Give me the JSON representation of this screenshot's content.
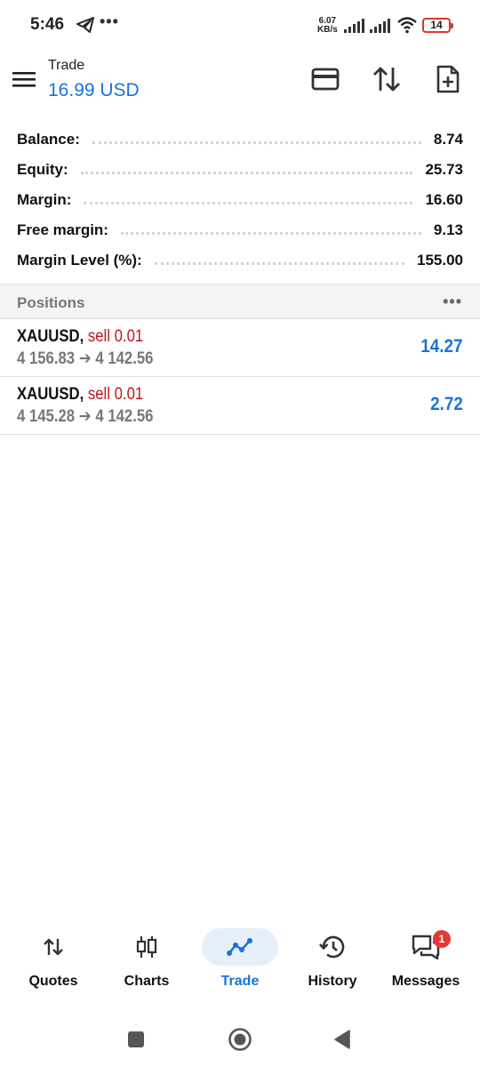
{
  "status_bar": {
    "time": "5:46",
    "more": "•••",
    "speed_value": "6.07",
    "speed_unit": "KB/s",
    "battery": "14"
  },
  "header": {
    "title": "Trade",
    "balance": "16.99 USD",
    "icons": [
      "menu-icon",
      "deposit-card-icon",
      "sort-icon",
      "new-order-icon"
    ]
  },
  "summary": {
    "rows": [
      {
        "label": "Balance:",
        "value": "8.74"
      },
      {
        "label": "Equity:",
        "value": "25.73"
      },
      {
        "label": "Margin:",
        "value": "16.60"
      },
      {
        "label": "Free margin:",
        "value": "9.13"
      },
      {
        "label": "Margin Level (%):",
        "value": "155.00"
      }
    ]
  },
  "positions": {
    "title": "Positions",
    "more": "•••",
    "items": [
      {
        "symbol": "XAUUSD,",
        "side": "sell 0.01",
        "prices": "4 156.83 ➔ 4 142.56",
        "profit": "14.27"
      },
      {
        "symbol": "XAUUSD,",
        "side": "sell 0.01",
        "prices": "4 145.28 ➔ 4 142.56",
        "profit": "2.72"
      }
    ]
  },
  "bottom_nav": {
    "items": [
      {
        "label": "Quotes",
        "icon": "quotes-icon"
      },
      {
        "label": "Charts",
        "icon": "charts-icon"
      },
      {
        "label": "Trade",
        "icon": "trade-icon",
        "active": true
      },
      {
        "label": "History",
        "icon": "history-icon"
      },
      {
        "label": "Messages",
        "icon": "messages-icon",
        "badge": "1"
      }
    ]
  },
  "colors": {
    "accent": "#1a73d9",
    "sell": "#c0141e",
    "badge": "#e53935"
  }
}
